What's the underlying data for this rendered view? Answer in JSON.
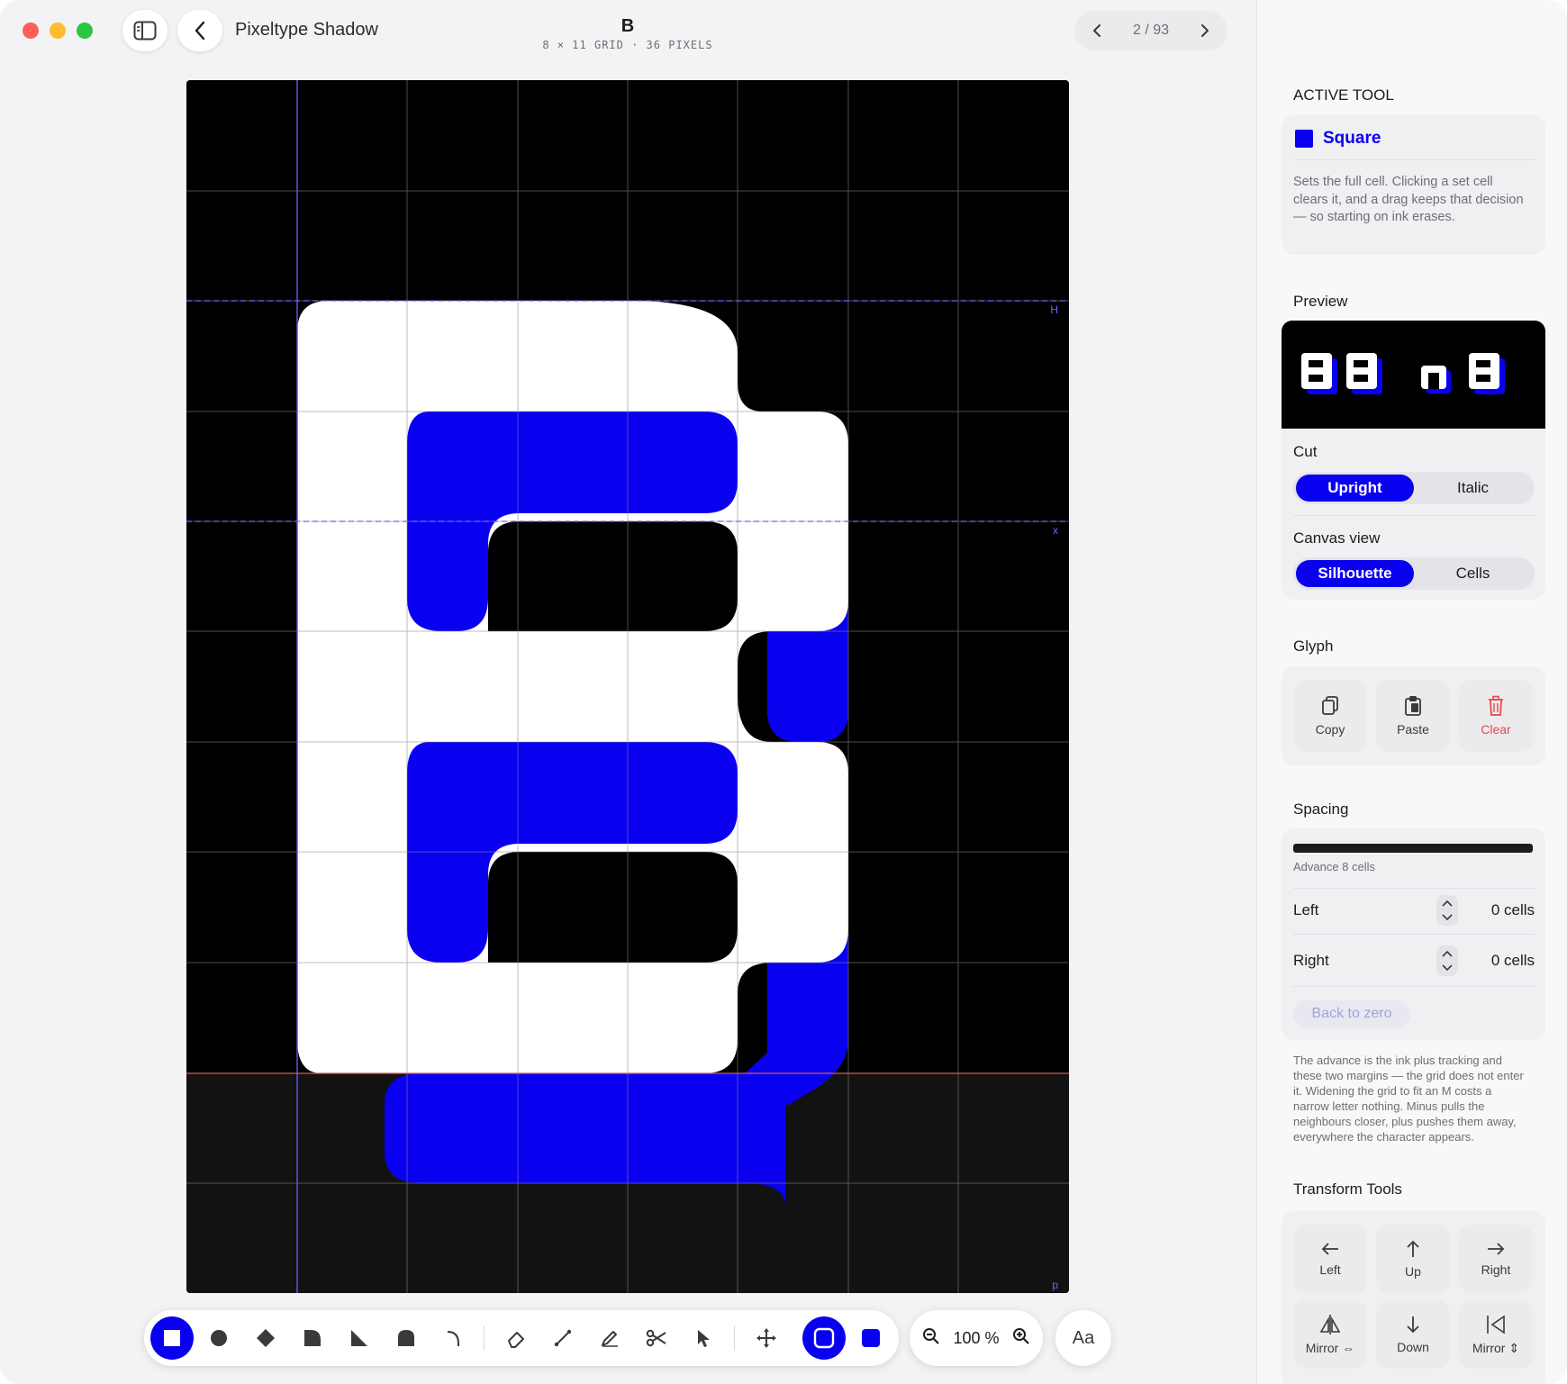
{
  "window": {
    "app_title": "Pixeltype Shadow",
    "glyph": "B",
    "grid_info": "8 × 11 GRID · 36 PIXELS",
    "pager": "2 / 93"
  },
  "canvas": {
    "guide_labels": {
      "cap_height": "H",
      "x_height": "x",
      "descender": "p"
    }
  },
  "toolbar": {
    "tools": [
      "square",
      "circle",
      "diamond",
      "quarter-round",
      "triangle",
      "arch",
      "corner",
      "eraser",
      "line",
      "pen",
      "scissors",
      "select",
      "move",
      "outline-fill",
      "solid-fill"
    ],
    "zoom_label": "100 %",
    "font_button": "Aa"
  },
  "sidebar": {
    "active_tool_heading": "ACTIVE TOOL",
    "active_tool_name": "Square",
    "active_tool_desc": "Sets the full cell. Clicking a set cell clears it, and a drag keeps that decision — so starting on ink erases.",
    "preview_heading": "Preview",
    "cut_heading": "Cut",
    "cut_options": [
      "Upright",
      "Italic"
    ],
    "canvas_view_heading": "Canvas view",
    "canvas_view_options": [
      "Silhouette",
      "Cells"
    ],
    "glyph_heading": "Glyph",
    "glyph_actions": [
      "Copy",
      "Paste",
      "Clear"
    ],
    "spacing_heading": "Spacing",
    "advance_label": "Advance 8 cells",
    "left_label": "Left",
    "left_value": "0 cells",
    "right_label": "Right",
    "right_value": "0 cells",
    "back_to_zero": "Back to zero",
    "spacing_note": "The advance is the ink plus tracking and these two margins — the grid does not enter it. Widening the grid to fit an M costs a narrow letter nothing. Minus pulls the neighbours closer, plus pushes them away, everywhere the character appears.",
    "transform_heading": "Transform Tools",
    "transform_actions": [
      "Left",
      "Up",
      "Right",
      "Mirror ⇔",
      "Down",
      "Mirror ⇕"
    ]
  },
  "colors": {
    "accent": "#0a00f0",
    "ink": "#ffffff",
    "shadow": "#0a00f0",
    "canvas_bg": "#000000",
    "danger": "#e5484d"
  }
}
